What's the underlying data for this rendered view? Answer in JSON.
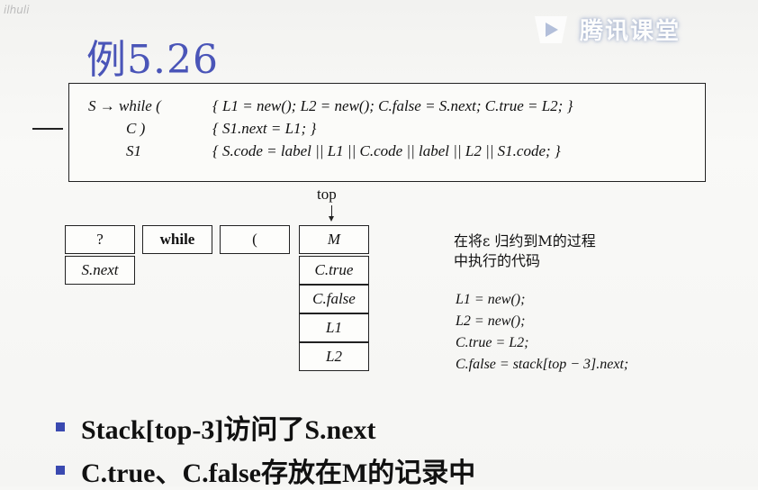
{
  "corner_mark": "ilhuli",
  "title": "例5.26",
  "logo": {
    "text": "腾讯课堂",
    "icon": "tencent-classroom-play-icon"
  },
  "grammar": [
    {
      "lhs": "S → while (",
      "rhs": "{ L1 = new(); L2 = new(); C.false = S.next; C.true = L2; }"
    },
    {
      "lhs": "C )",
      "rhs": "{ S1.next = L1; }"
    },
    {
      "lhs": "S1",
      "rhs": "{ S.code = label || L1 || C.code || label || L2 || S1.code; }"
    }
  ],
  "stack": {
    "top_label": "top",
    "col1": [
      "?",
      "S.next"
    ],
    "col2": [
      "while"
    ],
    "col3": [
      "("
    ],
    "col4": [
      "M",
      "C.true",
      "C.false",
      "L1",
      "L2"
    ]
  },
  "note": [
    "在将ε 归约到M的过程",
    "中执行的代码"
  ],
  "code_lines": [
    "L1 = new();",
    "L2 = new();",
    "C.true = L2;",
    "C.false = stack[top − 3].next;"
  ],
  "bullets": [
    "Stack[top-3]访问了S.next",
    "C.true、C.false存放在M的记录中"
  ],
  "colors": {
    "title": "#4a55b8",
    "bullet": "#3a49b0"
  }
}
